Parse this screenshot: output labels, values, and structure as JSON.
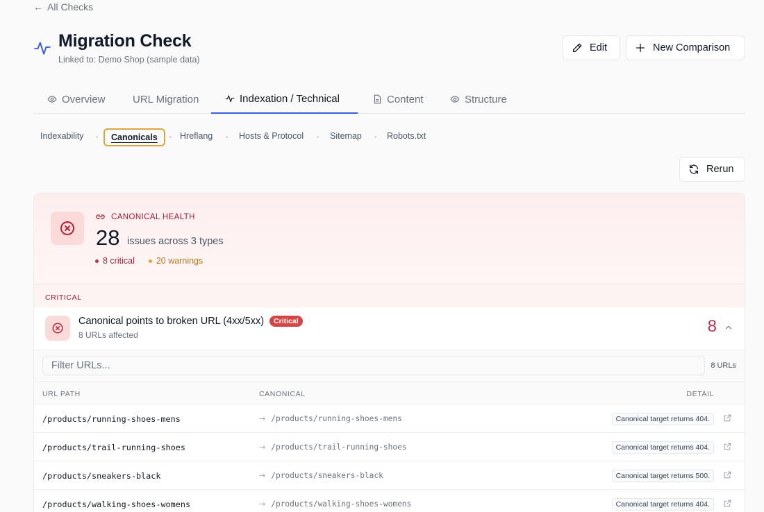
{
  "nav": {
    "back_label": "All Checks"
  },
  "header": {
    "title": "Migration Check",
    "subtitle": "Linked to: Demo Shop (sample data)",
    "edit_label": "Edit",
    "new_comparison_label": "New Comparison"
  },
  "tabs": [
    {
      "label": "Overview",
      "icon": "eye-icon"
    },
    {
      "label": "URL Migration",
      "icon": ""
    },
    {
      "label": "Indexation / Technical",
      "icon": "pulse-icon",
      "active": true
    },
    {
      "label": "Content",
      "icon": "document-icon"
    },
    {
      "label": "Structure",
      "icon": "eye-icon"
    }
  ],
  "subtabs": [
    {
      "label": "Indexability"
    },
    {
      "label": "Canonicals",
      "active": true
    },
    {
      "label": "Hreflang"
    },
    {
      "label": "Hosts & Protocol"
    },
    {
      "label": "Sitemap"
    },
    {
      "label": "Robots.txt"
    }
  ],
  "rerun_label": "Rerun",
  "health": {
    "label": "CANONICAL HEALTH",
    "count": "28",
    "description": "issues across 3 types",
    "critical_text": "8 critical",
    "warnings_text": "20 warnings",
    "critical_color": "#c0344f",
    "warning_color": "#e6a23c"
  },
  "section_critical": "CRITICAL",
  "issue": {
    "title": "Canonical points to broken URL (4xx/5xx)",
    "badge": "Critical",
    "sub": "8 URLs affected",
    "count": "8"
  },
  "filter": {
    "placeholder": "Filter URLs...",
    "count_label": "8 URLs"
  },
  "table": {
    "headers": {
      "path": "URL PATH",
      "canonical": "CANONICAL",
      "detail": "DETAIL"
    },
    "rows": [
      {
        "path": "/products/running-shoes-mens",
        "canonical": "/products/running-shoes-mens",
        "detail": "Canonical target returns 404."
      },
      {
        "path": "/products/trail-running-shoes",
        "canonical": "/products/trail-running-shoes",
        "detail": "Canonical target returns 404."
      },
      {
        "path": "/products/sneakers-black",
        "canonical": "/products/sneakers-black",
        "detail": "Canonical target returns 500."
      },
      {
        "path": "/products/walking-shoes-womens",
        "canonical": "/products/walking-shoes-womens",
        "detail": "Canonical target returns 404."
      }
    ]
  }
}
